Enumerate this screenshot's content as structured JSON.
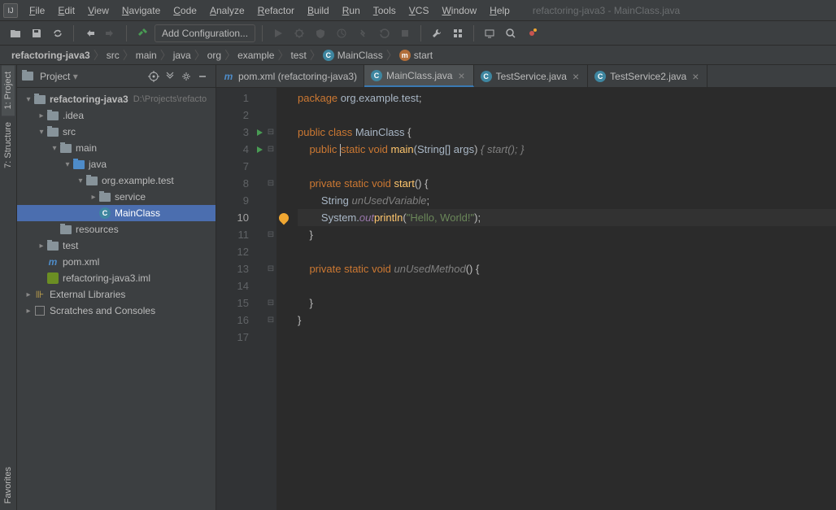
{
  "app": {
    "title": "refactoring-java3 - MainClass.java",
    "icon_label": "IJ"
  },
  "menu": [
    "File",
    "Edit",
    "View",
    "Navigate",
    "Code",
    "Analyze",
    "Refactor",
    "Build",
    "Run",
    "Tools",
    "VCS",
    "Window",
    "Help"
  ],
  "toolbar": {
    "add_config": "Add Configuration..."
  },
  "breadcrumbs": [
    {
      "label": "refactoring-java3",
      "bold": true
    },
    {
      "label": "src"
    },
    {
      "label": "main"
    },
    {
      "label": "java"
    },
    {
      "label": "org"
    },
    {
      "label": "example"
    },
    {
      "label": "test"
    },
    {
      "label": "MainClass",
      "icon": "class"
    },
    {
      "label": "start",
      "icon": "method"
    }
  ],
  "side_tabs": [
    {
      "label": "1: Project",
      "active": true
    },
    {
      "label": "7: Structure",
      "active": false
    }
  ],
  "bottom_tab": "Favorites",
  "sidebar": {
    "title": "Project",
    "tree": [
      {
        "depth": 0,
        "arrow": "open",
        "icon": "folder",
        "label": "refactoring-java3",
        "hint": "D:\\Projects\\refacto",
        "bold": true
      },
      {
        "depth": 1,
        "arrow": "close",
        "icon": "folder",
        "label": ".idea"
      },
      {
        "depth": 1,
        "arrow": "open",
        "icon": "folder",
        "label": "src"
      },
      {
        "depth": 2,
        "arrow": "open",
        "icon": "folder",
        "label": "main"
      },
      {
        "depth": 3,
        "arrow": "open",
        "icon": "folder-blue",
        "label": "java"
      },
      {
        "depth": 4,
        "arrow": "open",
        "icon": "folder",
        "label": "org.example.test"
      },
      {
        "depth": 5,
        "arrow": "close",
        "icon": "folder",
        "label": "service"
      },
      {
        "depth": 5,
        "arrow": "none",
        "icon": "class",
        "label": "MainClass",
        "selected": true
      },
      {
        "depth": 2,
        "arrow": "none",
        "icon": "folder",
        "label": "resources"
      },
      {
        "depth": 1,
        "arrow": "close",
        "icon": "folder",
        "label": "test"
      },
      {
        "depth": 1,
        "arrow": "none",
        "icon": "pom",
        "label": "pom.xml"
      },
      {
        "depth": 1,
        "arrow": "none",
        "icon": "iml",
        "label": "refactoring-java3.iml"
      },
      {
        "depth": 0,
        "arrow": "close",
        "icon": "lib",
        "label": "External Libraries"
      },
      {
        "depth": 0,
        "arrow": "close",
        "icon": "scratch",
        "label": "Scratches and Consoles"
      }
    ]
  },
  "editor_tabs": [
    {
      "label": "pom.xml (refactoring-java3)",
      "icon": "pom",
      "active": false,
      "closable": false
    },
    {
      "label": "MainClass.java",
      "icon": "class",
      "active": true,
      "closable": true
    },
    {
      "label": "TestService.java",
      "icon": "class",
      "active": false,
      "closable": true
    },
    {
      "label": "TestService2.java",
      "icon": "class",
      "active": false,
      "closable": true
    }
  ],
  "code": {
    "lines": [
      1,
      2,
      3,
      4,
      7,
      8,
      9,
      10,
      11,
      12,
      13,
      14,
      15,
      16,
      17
    ],
    "active_line": 10,
    "run_markers": [
      3,
      4
    ],
    "fold_markers": {
      "3": "⊟",
      "4": "⊟",
      "8": "⊟",
      "11": "⊟",
      "13": "⊟",
      "15": "⊟",
      "16": "⊟"
    },
    "bulb_line": 10,
    "tokens": {
      "l1": {
        "kw": "package",
        "pkg": " org.example.test",
        ";": ";"
      },
      "l3": {
        "kw1": "public ",
        "kw2": "class ",
        "name": "MainClass",
        " {": " {"
      },
      "l4": {
        "kw1": "public ",
        "kw2": "static ",
        "kw3": "void ",
        "name": "main",
        "paren": "(String[] ",
        "arg": "args",
        ") ": ") ",
        "brace": "{ ",
        "call": "start",
        "callEnd": "(); ",
        "close": "}"
      },
      "l8": {
        "kw1": "private ",
        "kw2": "static ",
        "kw3": "void ",
        "name": "start",
        "end": "() {"
      },
      "l9": {
        "type": "String ",
        "var": "unUsedVariable",
        ";": ";"
      },
      "l10": {
        "sys": "System.",
        "out": "out",
        ".": ".",
        "ptl": "println",
        "open": "(",
        "str": "\"Hello, World!\"",
        "close": ");"
      },
      "l11": "    }",
      "l13": {
        "kw1": "private ",
        "kw2": "static ",
        "kw3": "void ",
        "name": "unUsedMethod",
        "end": "() {"
      },
      "l15": "    }",
      "l16": "}"
    }
  }
}
